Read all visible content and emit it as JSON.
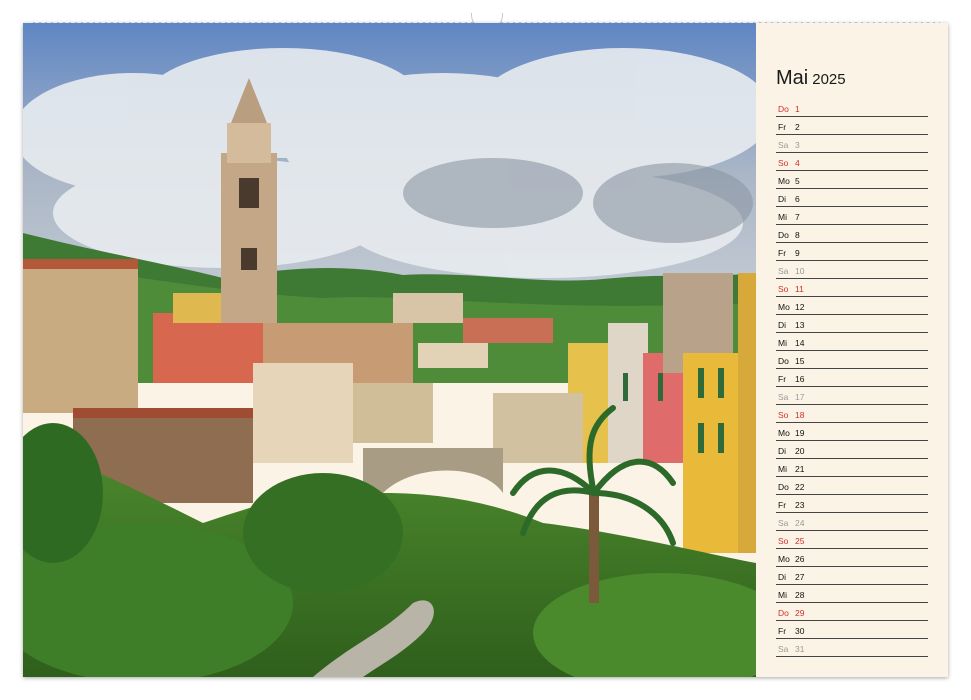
{
  "calendar": {
    "month": "Mai",
    "year": "2025"
  },
  "days": [
    {
      "wd": "Do",
      "d": "1",
      "type": "holiday"
    },
    {
      "wd": "Fr",
      "d": "2",
      "type": "weekday"
    },
    {
      "wd": "Sa",
      "d": "3",
      "type": "sat"
    },
    {
      "wd": "So",
      "d": "4",
      "type": "sun"
    },
    {
      "wd": "Mo",
      "d": "5",
      "type": "weekday"
    },
    {
      "wd": "Di",
      "d": "6",
      "type": "weekday"
    },
    {
      "wd": "Mi",
      "d": "7",
      "type": "weekday"
    },
    {
      "wd": "Do",
      "d": "8",
      "type": "weekday"
    },
    {
      "wd": "Fr",
      "d": "9",
      "type": "weekday"
    },
    {
      "wd": "Sa",
      "d": "10",
      "type": "sat"
    },
    {
      "wd": "So",
      "d": "11",
      "type": "sun"
    },
    {
      "wd": "Mo",
      "d": "12",
      "type": "weekday"
    },
    {
      "wd": "Di",
      "d": "13",
      "type": "weekday"
    },
    {
      "wd": "Mi",
      "d": "14",
      "type": "weekday"
    },
    {
      "wd": "Do",
      "d": "15",
      "type": "weekday"
    },
    {
      "wd": "Fr",
      "d": "16",
      "type": "weekday"
    },
    {
      "wd": "Sa",
      "d": "17",
      "type": "sat"
    },
    {
      "wd": "So",
      "d": "18",
      "type": "sun"
    },
    {
      "wd": "Mo",
      "d": "19",
      "type": "weekday"
    },
    {
      "wd": "Di",
      "d": "20",
      "type": "weekday"
    },
    {
      "wd": "Mi",
      "d": "21",
      "type": "weekday"
    },
    {
      "wd": "Do",
      "d": "22",
      "type": "weekday"
    },
    {
      "wd": "Fr",
      "d": "23",
      "type": "weekday"
    },
    {
      "wd": "Sa",
      "d": "24",
      "type": "sat"
    },
    {
      "wd": "So",
      "d": "25",
      "type": "sun"
    },
    {
      "wd": "Mo",
      "d": "26",
      "type": "weekday"
    },
    {
      "wd": "Di",
      "d": "27",
      "type": "weekday"
    },
    {
      "wd": "Mi",
      "d": "28",
      "type": "weekday"
    },
    {
      "wd": "Do",
      "d": "29",
      "type": "holiday"
    },
    {
      "wd": "Fr",
      "d": "30",
      "type": "weekday"
    },
    {
      "wd": "Sa",
      "d": "31",
      "type": "sat"
    }
  ],
  "colors": {
    "sunday_holiday": "#d0312d",
    "saturday": "#9a9a9a",
    "weekday": "#111111",
    "panel_bg": "#fbf3e6"
  }
}
